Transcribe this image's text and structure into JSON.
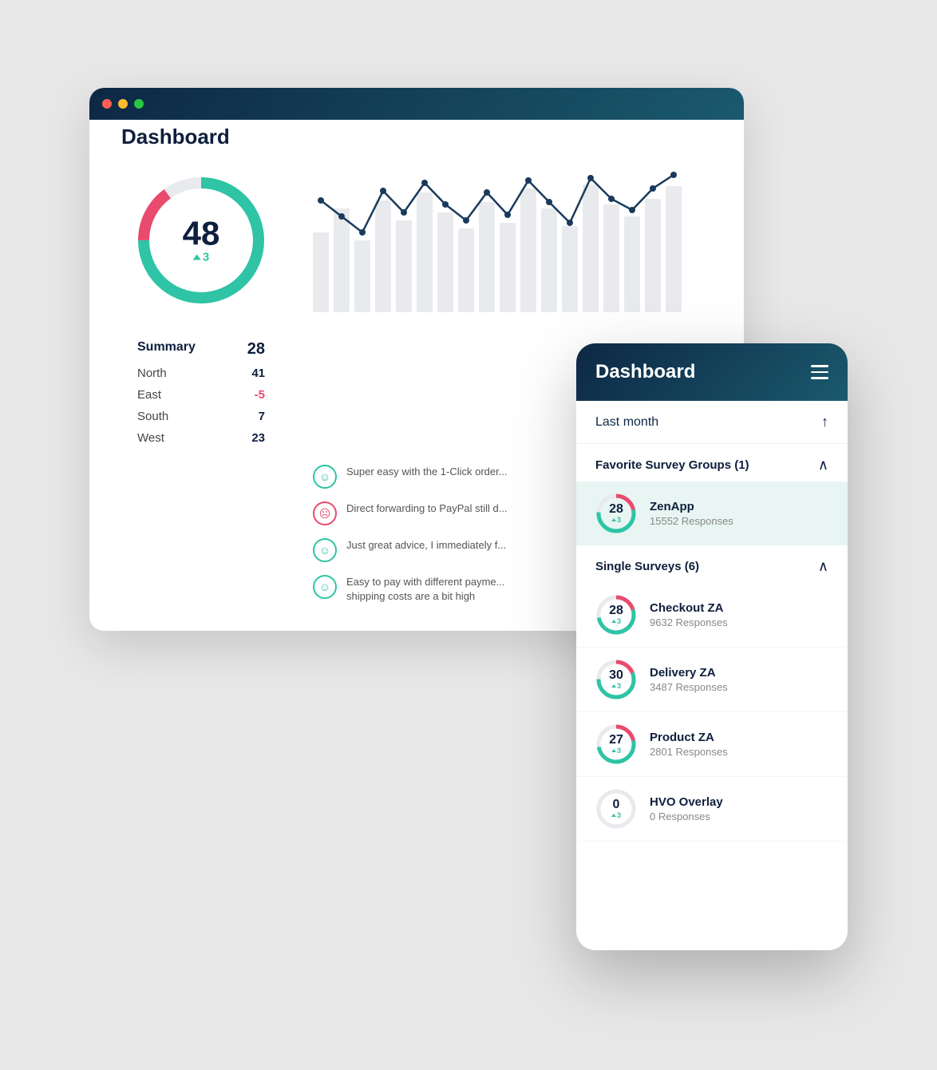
{
  "main_card": {
    "title": "Dashboard",
    "donut": {
      "value": "48",
      "delta": "3",
      "score": 48,
      "segments": [
        {
          "color": "#e84b6e",
          "pct": 15
        },
        {
          "color": "#2ec4a5",
          "pct": 75
        },
        {
          "color": "#e8eaed",
          "pct": 10
        }
      ]
    },
    "summary": {
      "label": "Summary",
      "header_val": "28",
      "rows": [
        {
          "label": "North",
          "value": "41"
        },
        {
          "label": "East",
          "value": "-5"
        },
        {
          "label": "South",
          "value": "7"
        },
        {
          "label": "West",
          "value": "23"
        }
      ]
    },
    "bars": [
      38,
      60,
      45,
      70,
      55,
      80,
      65,
      50,
      72,
      58,
      85,
      68,
      55,
      90,
      75,
      62,
      80,
      70
    ],
    "reviews": [
      {
        "type": "happy",
        "text": "Super easy with the 1-Click order..."
      },
      {
        "type": "sad",
        "text": "Direct forwarding to PayPal still d..."
      },
      {
        "type": "happy",
        "text": "Just great advice, I immediately f..."
      },
      {
        "type": "happy",
        "text": "Easy to pay with different payme... shipping costs are a bit high"
      }
    ]
  },
  "mobile_card": {
    "title": "Dashboard",
    "hamburger_label": "menu",
    "period_label": "Last month",
    "period_arrow": "↑",
    "favorite_groups": {
      "label": "Favorite Survey Groups (1)",
      "collapsed": false,
      "items": [
        {
          "name": "ZenApp",
          "responses": "15552 Responses",
          "score": 28,
          "delta": 3
        }
      ]
    },
    "single_surveys": {
      "label": "Single Surveys (6)",
      "collapsed": false,
      "items": [
        {
          "name": "Checkout ZA",
          "responses": "9632 Responses",
          "score": 28,
          "delta": 3
        },
        {
          "name": "Delivery ZA",
          "responses": "3487 Responses",
          "score": 30,
          "delta": 3
        },
        {
          "name": "Product ZA",
          "responses": "2801 Responses",
          "score": 27,
          "delta": 3
        },
        {
          "name": "HVO Overlay",
          "responses": "0 Responses",
          "score": 0,
          "delta": 3
        }
      ]
    }
  }
}
